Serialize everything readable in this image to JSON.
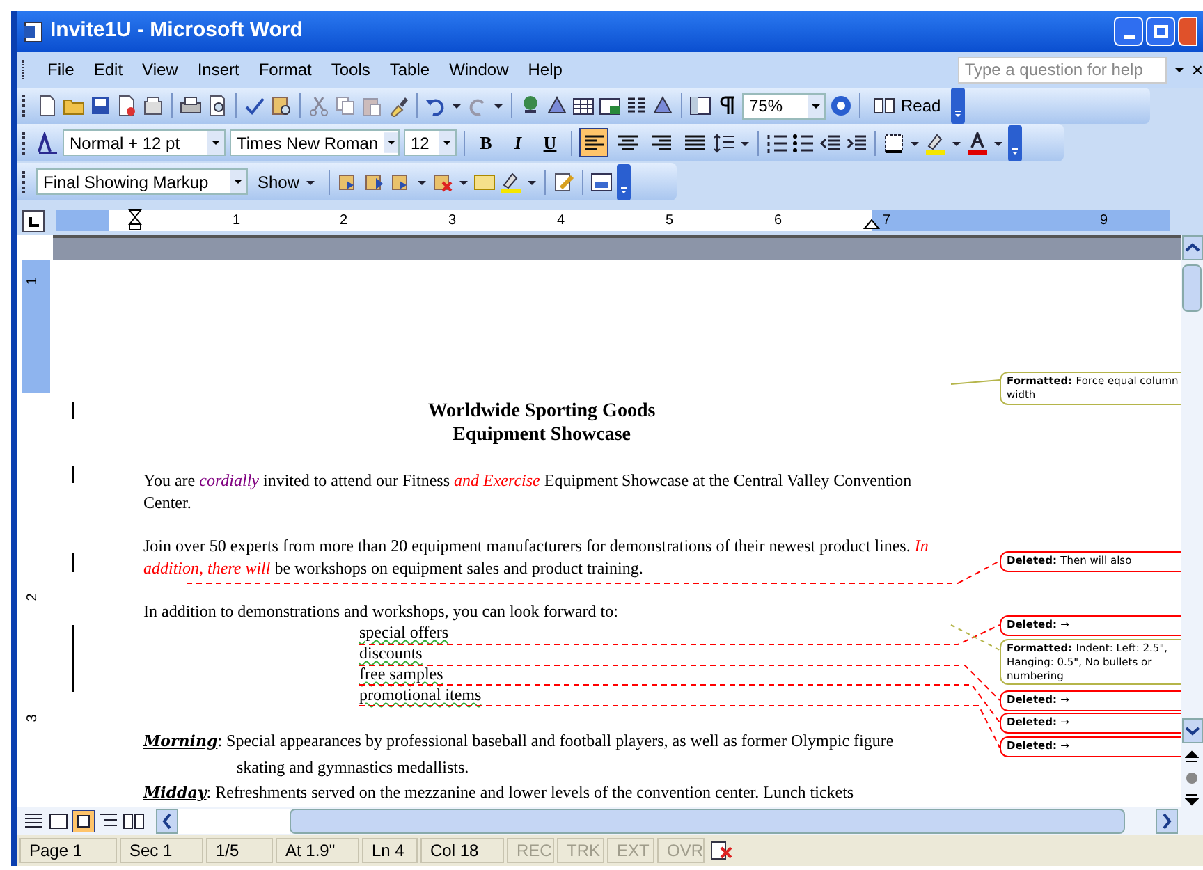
{
  "window": {
    "title": "Invite1U - Microsoft Word"
  },
  "menu": {
    "items": [
      "File",
      "Edit",
      "View",
      "Insert",
      "Format",
      "Tools",
      "Table",
      "Window",
      "Help"
    ],
    "help_box": {
      "placeholder": "Type a question for help"
    },
    "close": "×"
  },
  "standard_toolbar": {
    "zoom": "75%",
    "read": "Read"
  },
  "formatting_toolbar": {
    "style": "Normal + 12 pt",
    "font": "Times New Roman",
    "size": "12",
    "buttons": [
      {
        "label": "B",
        "kind": "bold"
      },
      {
        "label": "I",
        "kind": "italic"
      },
      {
        "label": "U",
        "kind": "underline"
      }
    ],
    "alignments": [
      {
        "kind": "left",
        "selected": true
      },
      {
        "kind": "center",
        "selected": false
      },
      {
        "kind": "right",
        "selected": false
      },
      {
        "kind": "justify",
        "selected": false
      }
    ]
  },
  "reviewing_toolbar": {
    "display": "Final Showing Markup",
    "show": "Show"
  },
  "ruler": {
    "marks": [
      "1",
      "2",
      "3",
      "4",
      "5",
      "6",
      "7",
      "9"
    ]
  },
  "vertical_ruler": {
    "marks": [
      "1",
      "2",
      "3"
    ]
  },
  "document": {
    "title": [
      "Worldwide Sporting Goods",
      "Equipment Showcase"
    ],
    "paragraphs": [
      {
        "kind": "body",
        "runs": [
          {
            "text": "You are ",
            "kind": "plain"
          },
          {
            "text": "cordially",
            "kind": "insertion",
            "color": "#800080"
          },
          {
            "text": " invited to attend our Fitness ",
            "kind": "plain"
          },
          {
            "text": "and Exercise",
            "kind": "insertion",
            "color": "#ff0000"
          },
          {
            "text": " Equipment Showcase at the Central Valley Convention Center.",
            "kind": "plain"
          }
        ]
      },
      {
        "kind": "body",
        "runs": [
          {
            "text": "Join over 50 experts from more than 20 equipment manufacturers for demonstrations of their newest product lines.  ",
            "kind": "plain"
          },
          {
            "text": "In addition, there will",
            "kind": "insertion",
            "color": "#ff0000"
          },
          {
            "text": " be workshops on equipment sales and product training.",
            "kind": "plain"
          }
        ]
      },
      {
        "kind": "intro",
        "runs": [
          {
            "text": "In addition to demonstrations and workshops, you can look forward to:",
            "kind": "plain"
          }
        ]
      }
    ],
    "list": [
      "special offers",
      "discounts",
      "free samples",
      "promotional items"
    ],
    "schedule": [
      {
        "label": "Morning",
        "text": ": Special appearances by professional baseball and football players, as well as former Olympic figure skating and gymnastics medallists."
      },
      {
        "label": "Midday",
        "text": ": Refreshments served on the mezzanine and lower levels of the convention center.  Lunch tickets"
      }
    ]
  },
  "balloons": [
    {
      "kind": "formatted",
      "label": "Formatted:",
      "text": "Force equal column width"
    },
    {
      "kind": "deleted",
      "label": "Deleted:",
      "text": "Then will also"
    },
    {
      "kind": "deleted",
      "label": "Deleted:",
      "text": "→"
    },
    {
      "kind": "formatted",
      "label": "Formatted:",
      "text": "Indent: Left: 2.5\", Hanging: 0.5\", No bullets or numbering"
    },
    {
      "kind": "deleted",
      "label": "Deleted:",
      "text": "→"
    },
    {
      "kind": "deleted",
      "label": "Deleted:",
      "text": "→"
    },
    {
      "kind": "deleted",
      "label": "Deleted:",
      "text": "→"
    }
  ],
  "status_bar": {
    "fields": [
      {
        "text": "Page 1",
        "disabled": false
      },
      {
        "text": "Sec 1",
        "disabled": false
      },
      {
        "text": "1/5",
        "disabled": false
      },
      {
        "text": "At 1.9\"",
        "disabled": false
      },
      {
        "text": "Ln 4",
        "disabled": false
      },
      {
        "text": "Col 18",
        "disabled": false
      },
      {
        "text": "REC",
        "disabled": true
      },
      {
        "text": "TRK",
        "disabled": true
      },
      {
        "text": "EXT",
        "disabled": true
      },
      {
        "text": "OVR",
        "disabled": true
      }
    ]
  }
}
